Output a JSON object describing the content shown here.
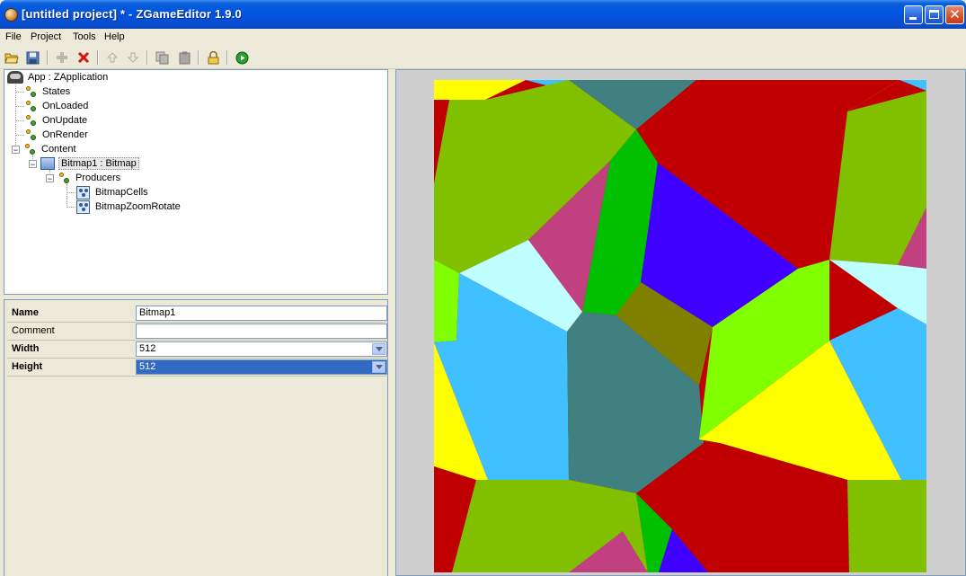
{
  "window": {
    "title": "[untitled project] * - ZGameEditor 1.9.0",
    "buttons": {
      "min_icon": "minimize-icon",
      "max_icon": "maximize-icon",
      "close_icon": "close-icon"
    }
  },
  "menu": [
    "File",
    "Project",
    "Tools",
    "Help"
  ],
  "toolbar": {
    "icons": [
      "open-folder-icon",
      "save-icon",
      "add-icon",
      "delete-icon",
      "move-up-icon",
      "move-down-icon",
      "copy-icon",
      "paste-icon",
      "lock-icon",
      "run-icon"
    ]
  },
  "tree": {
    "root": "App : ZApplication",
    "children": [
      "States",
      "OnLoaded",
      "OnUpdate",
      "OnRender",
      "Content"
    ],
    "content_child": "Bitmap1 : Bitmap",
    "producers_label": "Producers",
    "producers": [
      "BitmapCells",
      "BitmapZoomRotate"
    ]
  },
  "properties": [
    {
      "name": "Name",
      "value": "Bitmap1",
      "bold": true
    },
    {
      "name": "Comment",
      "value": "",
      "bold": false
    },
    {
      "name": "Width",
      "value": "512",
      "bold": true
    },
    {
      "name": "Height",
      "value": "512",
      "bold": true
    }
  ],
  "preview": {
    "colors": {
      "red": "#c00000",
      "olive": "#80c000",
      "green": "#00c000",
      "lime": "#80ff00",
      "blue": "#4000ff",
      "magenta": "#c04080",
      "lightcyan": "#c0ffff",
      "skyblue": "#40c0ff",
      "teal": "#408080",
      "darkolive": "#808000",
      "yellow": "#ffff00"
    }
  }
}
